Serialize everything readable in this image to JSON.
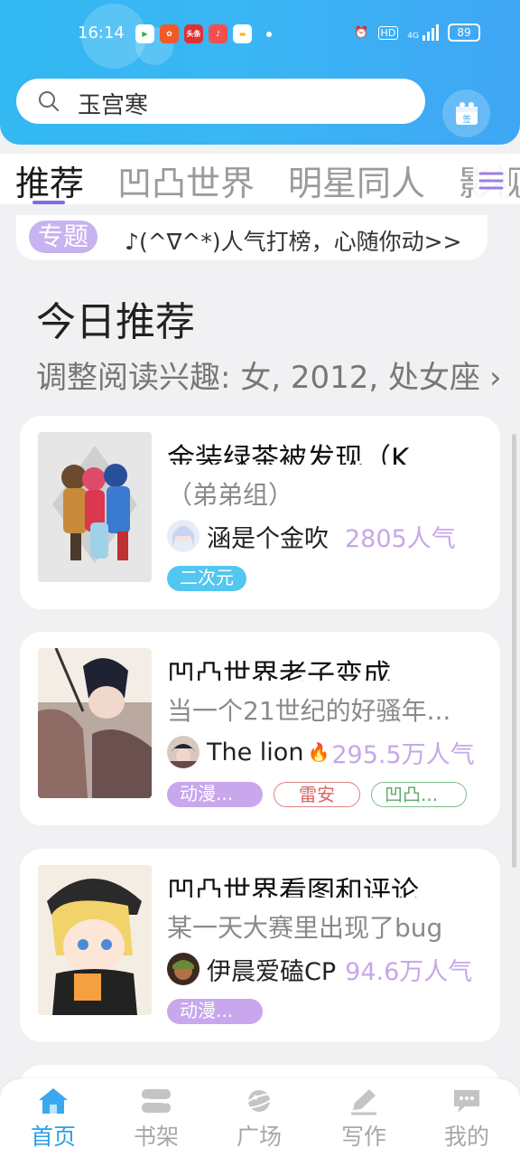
{
  "status_bar": {
    "time": "16:14",
    "network": "4G",
    "hd": "HD",
    "battery": "89",
    "app_badge": "头条"
  },
  "search": {
    "value": "玉宫寒"
  },
  "sign_in": {
    "label": "签"
  },
  "tabs": [
    {
      "label": "推荐",
      "active": true
    },
    {
      "label": "凹凸世界",
      "active": false
    },
    {
      "label": "明星同人",
      "active": false
    },
    {
      "label": "影视",
      "active": false
    }
  ],
  "topic_banner": {
    "tag": "专题",
    "text": "♪(^∇^*)人气打榜，心随你动>>"
  },
  "recommend": {
    "title": "今日推荐",
    "subtitle": "调整阅读兴趣: 女, 2012, 处女座"
  },
  "books": [
    {
      "title": "金装绿茶被发现（K",
      "desc": "（弟弟组）",
      "author": "涵是个金吹",
      "popularity": "2805人气",
      "hot": false,
      "tags": [
        {
          "label": "二次元",
          "style": "blue"
        }
      ]
    },
    {
      "title": "凹凸世界老子变成",
      "desc": "当一个21世纪的好骚年...",
      "author": "The lion",
      "popularity": "295.5万人气",
      "hot": true,
      "tags": [
        {
          "label": "动漫...",
          "style": "purple"
        },
        {
          "label": "雷安",
          "style": "red"
        },
        {
          "label": "凹凸...",
          "style": "green"
        }
      ]
    },
    {
      "title": "凹凸世界看图和评论",
      "desc": "某一天大赛里出现了bug",
      "author": "伊晨爱磕CP",
      "popularity": "94.6万人气",
      "hot": false,
      "tags": [
        {
          "label": "动漫...",
          "style": "purple"
        }
      ]
    }
  ],
  "bottom_nav": [
    {
      "label": "首页",
      "icon": "home-icon",
      "active": true
    },
    {
      "label": "书架",
      "icon": "bookshelf-icon",
      "active": false
    },
    {
      "label": "广场",
      "icon": "planet-icon",
      "active": false
    },
    {
      "label": "写作",
      "icon": "pen-icon",
      "active": false
    },
    {
      "label": "我的",
      "icon": "chat-icon",
      "active": false
    }
  ],
  "colors": {
    "header": "#3ab6f4",
    "accent_purple": "#c7a7e8",
    "nav_active": "#2a9fe8"
  }
}
